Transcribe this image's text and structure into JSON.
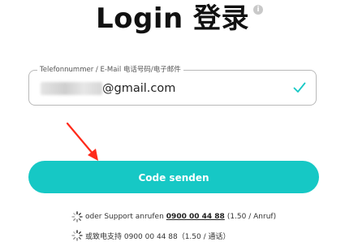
{
  "header": {
    "title": "Login  登录",
    "info_icon": "info-icon"
  },
  "login_field": {
    "label": "Telefonnummer / E-Mail 电话号码/电子邮件",
    "value_visible": "@gmail.com",
    "valid_icon": "check-icon"
  },
  "annotation": {
    "arrow_color": "#ff2a1a",
    "arrow_icon": "arrow-pointer"
  },
  "send_button": {
    "label": "Code senden",
    "color": "#16c8c5"
  },
  "support": {
    "line1_prefix": "oder Support anrufen",
    "line1_phone": "0900 00 44 88",
    "line1_suffix": "(1.50 / Anruf)",
    "line2_text": "或致电支持 0900 00 44 88（1.50 / 通话）",
    "icon": "spinner-icon"
  }
}
